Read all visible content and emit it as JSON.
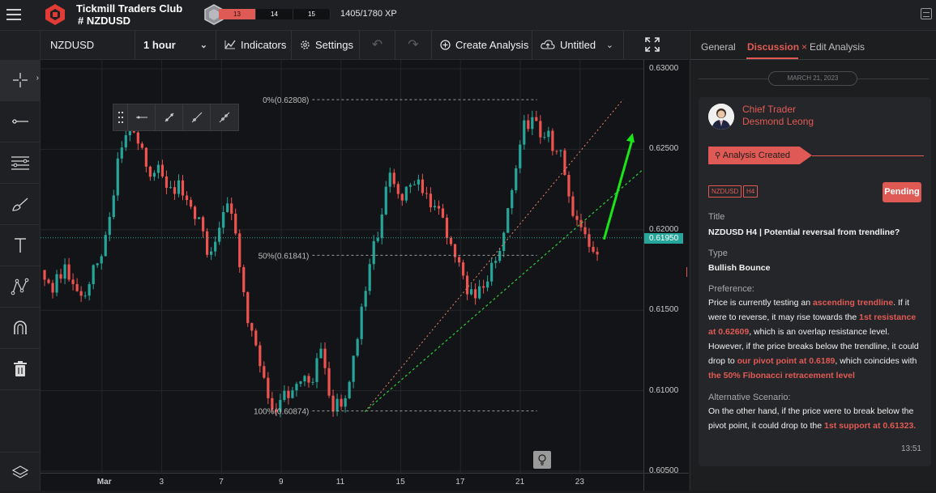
{
  "app": {
    "club_name": "Tickmill Traders Club",
    "symbol_heading": "# NZDUSD",
    "xp_levels": [
      "13",
      "14",
      "15"
    ],
    "xp_progress": "1405/1780 XP",
    "xp_fraction": 0.79
  },
  "toolbar": {
    "symbol": "NZDUSD",
    "interval": "1 hour",
    "indicators_label": "Indicators",
    "settings_label": "Settings",
    "create_analysis_label": "Create Analysis",
    "layout_name": "Untitled"
  },
  "left_tools": [
    "crosshair-icon",
    "horizontal-line-icon",
    "fibonacci-icon",
    "brush-icon",
    "text-icon",
    "pattern-icon",
    "magnet-icon",
    "trash-icon",
    "layers-icon"
  ],
  "chart_data": {
    "type": "candlestick",
    "symbol": "NZDUSD",
    "timeframe": "H4",
    "y_ticks": [
      "0.63000",
      "0.62500",
      "0.62000",
      "0.61500",
      "0.61000",
      "0.60500"
    ],
    "ylim": [
      0.605,
      0.63
    ],
    "x_ticks": [
      "Mar",
      "3",
      "7",
      "9",
      "11",
      "15",
      "17",
      "21",
      "23"
    ],
    "current_price": "0.61950",
    "current_price_value": 0.6195,
    "fib_levels": [
      {
        "label": "0%(0.62808)",
        "value": 0.62808
      },
      {
        "label": "50%(0.61841)",
        "value": 0.61841
      },
      {
        "label": "100%(0.60874)",
        "value": 0.60874
      }
    ],
    "close_path": [
      [
        0,
        0.6175
      ],
      [
        2,
        0.6163
      ],
      [
        4,
        0.6178
      ],
      [
        6,
        0.617
      ],
      [
        8,
        0.6155
      ],
      [
        10,
        0.618
      ],
      [
        12,
        0.6187
      ],
      [
        14,
        0.6215
      ],
      [
        16,
        0.6255
      ],
      [
        18,
        0.6264
      ],
      [
        20,
        0.625
      ],
      [
        22,
        0.6231
      ],
      [
        24,
        0.6236
      ],
      [
        26,
        0.6223
      ],
      [
        28,
        0.623
      ],
      [
        30,
        0.6212
      ],
      [
        32,
        0.6205
      ],
      [
        34,
        0.6188
      ],
      [
        36,
        0.6192
      ],
      [
        38,
        0.6215
      ],
      [
        40,
        0.6198
      ],
      [
        42,
        0.615
      ],
      [
        44,
        0.6125
      ],
      [
        46,
        0.6105
      ],
      [
        48,
        0.609
      ],
      [
        50,
        0.6095
      ],
      [
        52,
        0.6105
      ],
      [
        54,
        0.6102
      ],
      [
        56,
        0.611
      ],
      [
        58,
        0.6128
      ],
      [
        60,
        0.6094
      ],
      [
        62,
        0.6088
      ],
      [
        64,
        0.6105
      ],
      [
        66,
        0.615
      ],
      [
        68,
        0.618
      ],
      [
        70,
        0.62
      ],
      [
        72,
        0.6232
      ],
      [
        74,
        0.6225
      ],
      [
        76,
        0.622
      ],
      [
        78,
        0.6232
      ],
      [
        80,
        0.6225
      ],
      [
        82,
        0.621
      ],
      [
        84,
        0.62
      ],
      [
        86,
        0.6185
      ],
      [
        88,
        0.6165
      ],
      [
        90,
        0.616
      ],
      [
        92,
        0.617
      ],
      [
        94,
        0.6175
      ],
      [
        96,
        0.6195
      ],
      [
        98,
        0.6235
      ],
      [
        100,
        0.626
      ],
      [
        102,
        0.6275
      ],
      [
        104,
        0.626
      ],
      [
        106,
        0.6255
      ],
      [
        108,
        0.6245
      ],
      [
        110,
        0.6218
      ],
      [
        112,
        0.62
      ],
      [
        114,
        0.6192
      ],
      [
        116,
        0.6187
      ]
    ],
    "trendline_ascending": [
      [
        67,
        0.6087
      ],
      [
        125,
        0.6237
      ]
    ],
    "trendline_fib_diagonal": [
      [
        67,
        0.6087
      ],
      [
        121,
        0.6281
      ]
    ],
    "forecast_arrow": [
      [
        117,
        0.6194
      ],
      [
        123,
        0.626
      ]
    ],
    "colors": {
      "up": "#26a69a",
      "down": "#ef5350",
      "trend": "#2ecc40",
      "arrow": "#19e619",
      "fib": "#9b9b9b"
    }
  },
  "panel": {
    "tabs": [
      "General",
      "Discussion",
      "Edit Analysis"
    ],
    "active_tab": "Discussion",
    "date": "MARCH 21, 2023",
    "author_role": "Chief Trader",
    "author_name": "Desmond Leong",
    "status": "Analysis Created",
    "tags": [
      "NZDUSD",
      "H4"
    ],
    "badge": "Pending",
    "title_label": "Title",
    "title_value": "NZDUSD H4 | Potential reversal from trendline?",
    "type_label": "Type",
    "type_value": "Bullish Bounce",
    "preference_label": "Preference:",
    "preference_parts": [
      {
        "text": "Price is currently testing an ",
        "hl": false
      },
      {
        "text": "ascending trendline",
        "hl": true
      },
      {
        "text": ". If it were to reverse, it may rise towards the ",
        "hl": false
      },
      {
        "text": "1st resistance at 0.62609",
        "hl": true
      },
      {
        "text": ", which is an overlap resistance level. However, if the price breaks below the trendline, it could drop to ",
        "hl": false
      },
      {
        "text": "our pivot point at 0.6189",
        "hl": true
      },
      {
        "text": ", which coincides with ",
        "hl": false
      },
      {
        "text": "the 50% Fibonacci retracement level",
        "hl": true
      }
    ],
    "alt_label": "Alternative Scenario:",
    "alt_parts": [
      {
        "text": "On the other hand, if the price were to break below the pivot point, it could drop to the ",
        "hl": false
      },
      {
        "text": "1st support at 0.61323.",
        "hl": true
      }
    ],
    "timestamp": "13:51"
  }
}
